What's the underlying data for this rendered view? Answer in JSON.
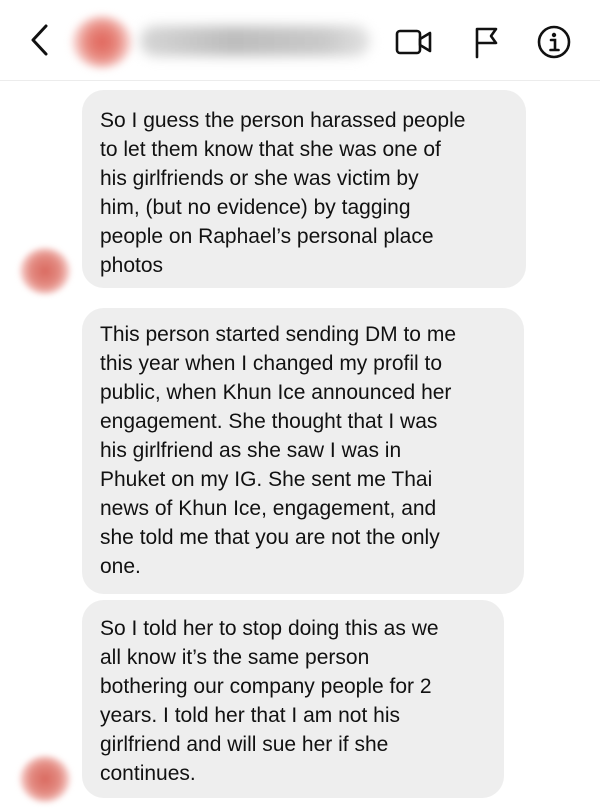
{
  "header": {
    "back_icon": "chevron-left-icon",
    "video_icon": "video-camera-icon",
    "flag_icon": "flag-icon",
    "info_icon": "info-icon"
  },
  "messages": [
    {
      "text": "So I guess the person harassed people\nto let them know that she was one of\nhis girlfriends or she was victim by\nhim, (but no evidence) by tagging\npeople on Raphael’s personal place\nphotos"
    },
    {
      "text": "This person started sending DM to me\nthis year when I changed my profil to\npublic, when Khun Ice announced her\nengagement. She thought that I was\nhis girlfriend as she saw I was in\nPhuket on my IG. She sent me Thai\nnews of Khun Ice, engagement, and\nshe told me that you are not the only\none."
    },
    {
      "text": "So I told her to stop doing this as we\nall know it’s the same person\nbothering our company people for 2\nyears. I told her that I am not his\ngirlfriend and will sue her if she\ncontinues."
    }
  ],
  "colors": {
    "bubble": "#eeeeee",
    "text": "#111111",
    "icon": "#111111"
  }
}
